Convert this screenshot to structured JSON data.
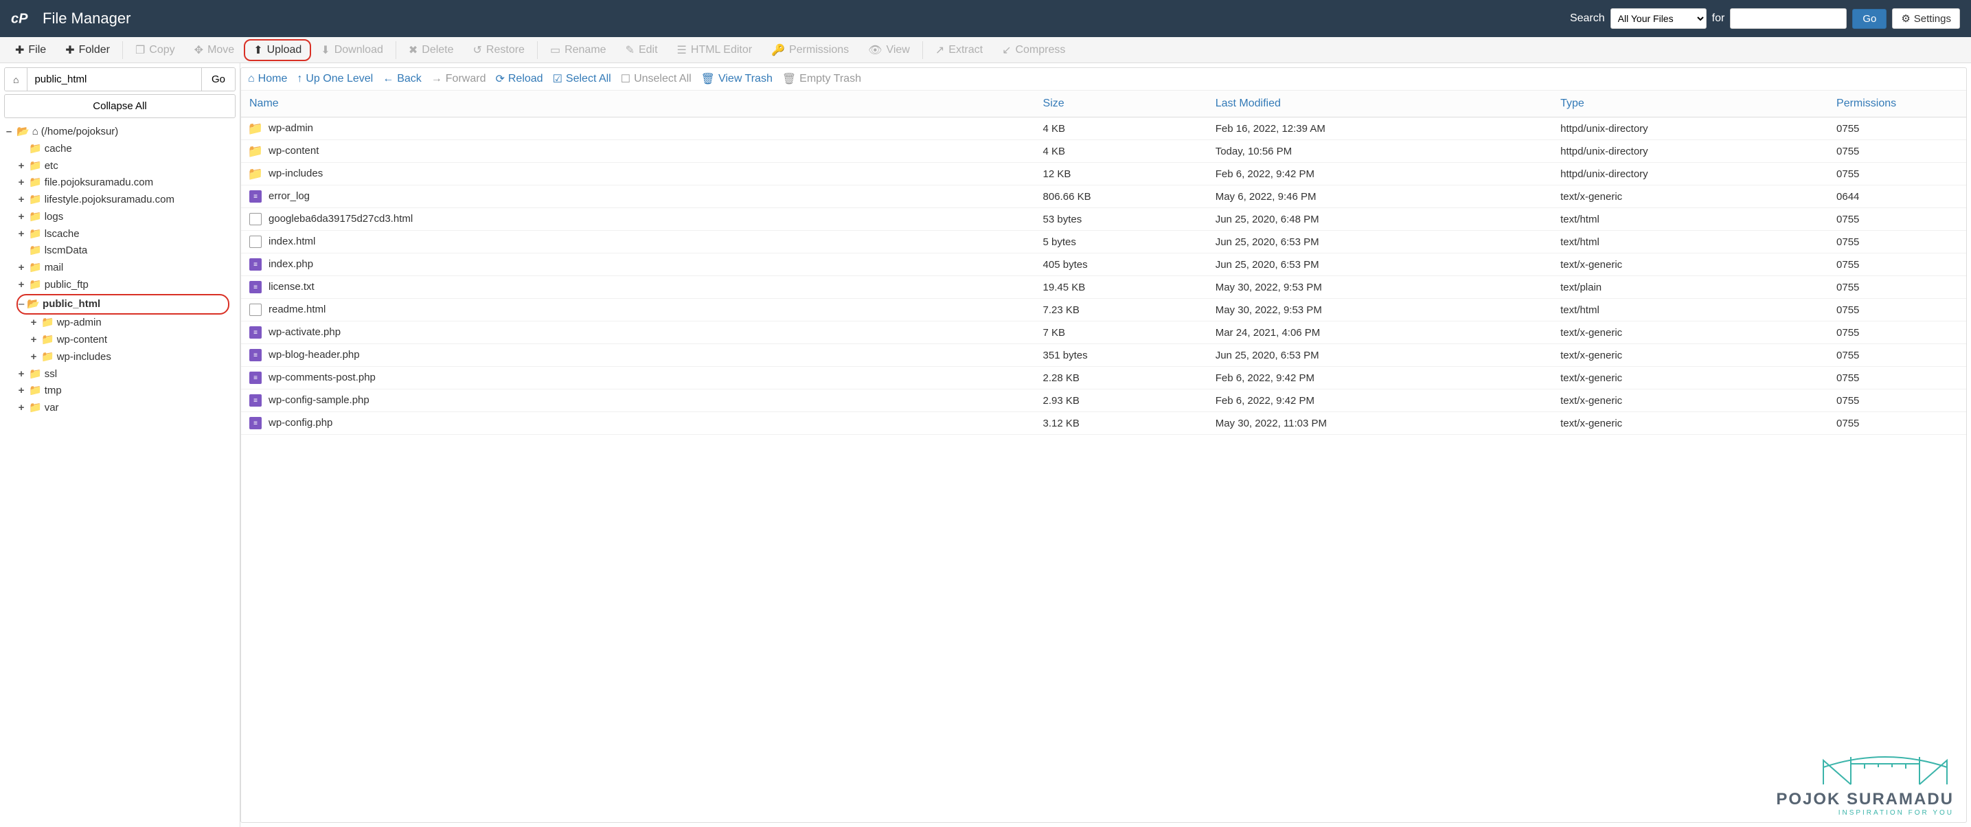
{
  "header": {
    "title": "File Manager",
    "search_label": "Search",
    "search_scope": "All Your Files",
    "for_label": "for",
    "search_value": "",
    "go": "Go",
    "settings": "Settings"
  },
  "toolbar": {
    "file": "File",
    "folder": "Folder",
    "copy": "Copy",
    "move": "Move",
    "upload": "Upload",
    "download": "Download",
    "delete": "Delete",
    "restore": "Restore",
    "rename": "Rename",
    "edit": "Edit",
    "html_editor": "HTML Editor",
    "permissions": "Permissions",
    "view": "View",
    "extract": "Extract",
    "compress": "Compress"
  },
  "sidebar": {
    "path_value": "public_html",
    "go": "Go",
    "collapse_all": "Collapse All",
    "root_label": "(/home/pojoksur)",
    "tree": [
      {
        "label": "cache",
        "expandable": false
      },
      {
        "label": "etc",
        "expandable": true
      },
      {
        "label": "file.pojoksuramadu.com",
        "expandable": true
      },
      {
        "label": "lifestyle.pojoksuramadu.com",
        "expandable": true
      },
      {
        "label": "logs",
        "expandable": true
      },
      {
        "label": "lscache",
        "expandable": true
      },
      {
        "label": "lscmData",
        "expandable": false
      },
      {
        "label": "mail",
        "expandable": true
      },
      {
        "label": "public_ftp",
        "expandable": true
      },
      {
        "label": "public_html",
        "expandable": true,
        "selected": true,
        "open": true,
        "children": [
          {
            "label": "wp-admin",
            "expandable": true
          },
          {
            "label": "wp-content",
            "expandable": true
          },
          {
            "label": "wp-includes",
            "expandable": true
          }
        ]
      },
      {
        "label": "ssl",
        "expandable": true
      },
      {
        "label": "tmp",
        "expandable": true
      },
      {
        "label": "var",
        "expandable": true
      }
    ]
  },
  "actions": {
    "home": "Home",
    "up": "Up One Level",
    "back": "Back",
    "forward": "Forward",
    "reload": "Reload",
    "select_all": "Select All",
    "unselect_all": "Unselect All",
    "view_trash": "View Trash",
    "empty_trash": "Empty Trash"
  },
  "columns": {
    "name": "Name",
    "size": "Size",
    "modified": "Last Modified",
    "type": "Type",
    "permissions": "Permissions"
  },
  "files": [
    {
      "icon": "folder",
      "name": "wp-admin",
      "size": "4 KB",
      "modified": "Feb 16, 2022, 12:39 AM",
      "type": "httpd/unix-directory",
      "perm": "0755"
    },
    {
      "icon": "folder",
      "name": "wp-content",
      "size": "4 KB",
      "modified": "Today, 10:56 PM",
      "type": "httpd/unix-directory",
      "perm": "0755"
    },
    {
      "icon": "folder",
      "name": "wp-includes",
      "size": "12 KB",
      "modified": "Feb 6, 2022, 9:42 PM",
      "type": "httpd/unix-directory",
      "perm": "0755"
    },
    {
      "icon": "doc",
      "name": "error_log",
      "size": "806.66 KB",
      "modified": "May 6, 2022, 9:46 PM",
      "type": "text/x-generic",
      "perm": "0644"
    },
    {
      "icon": "html",
      "name": "googleba6da39175d27cd3.html",
      "size": "53 bytes",
      "modified": "Jun 25, 2020, 6:48 PM",
      "type": "text/html",
      "perm": "0755"
    },
    {
      "icon": "html",
      "name": "index.html",
      "size": "5 bytes",
      "modified": "Jun 25, 2020, 6:53 PM",
      "type": "text/html",
      "perm": "0755"
    },
    {
      "icon": "doc",
      "name": "index.php",
      "size": "405 bytes",
      "modified": "Jun 25, 2020, 6:53 PM",
      "type": "text/x-generic",
      "perm": "0755"
    },
    {
      "icon": "doc",
      "name": "license.txt",
      "size": "19.45 KB",
      "modified": "May 30, 2022, 9:53 PM",
      "type": "text/plain",
      "perm": "0755"
    },
    {
      "icon": "html",
      "name": "readme.html",
      "size": "7.23 KB",
      "modified": "May 30, 2022, 9:53 PM",
      "type": "text/html",
      "perm": "0755"
    },
    {
      "icon": "doc",
      "name": "wp-activate.php",
      "size": "7 KB",
      "modified": "Mar 24, 2021, 4:06 PM",
      "type": "text/x-generic",
      "perm": "0755"
    },
    {
      "icon": "doc",
      "name": "wp-blog-header.php",
      "size": "351 bytes",
      "modified": "Jun 25, 2020, 6:53 PM",
      "type": "text/x-generic",
      "perm": "0755"
    },
    {
      "icon": "doc",
      "name": "wp-comments-post.php",
      "size": "2.28 KB",
      "modified": "Feb 6, 2022, 9:42 PM",
      "type": "text/x-generic",
      "perm": "0755"
    },
    {
      "icon": "doc",
      "name": "wp-config-sample.php",
      "size": "2.93 KB",
      "modified": "Feb 6, 2022, 9:42 PM",
      "type": "text/x-generic",
      "perm": "0755"
    },
    {
      "icon": "doc",
      "name": "wp-config.php",
      "size": "3.12 KB",
      "modified": "May 30, 2022, 11:03 PM",
      "type": "text/x-generic",
      "perm": "0755"
    }
  ],
  "watermark": {
    "brand": "POJOK SURAMADU",
    "tagline": "INSPIRATION FOR YOU"
  }
}
